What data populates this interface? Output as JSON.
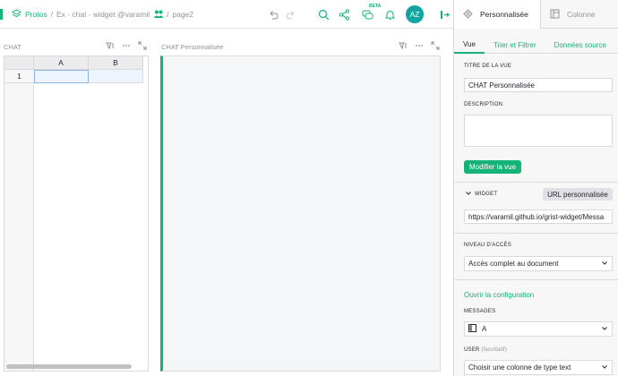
{
  "breadcrumb": {
    "project": "Protos",
    "doc": "Ex - chat - widget @varamil",
    "page": "page2",
    "sep": "/"
  },
  "toolbar": {
    "beta": "BETA",
    "avatar": "AZ"
  },
  "sections": {
    "left_title": "CHAT",
    "right_title": "CHAT Personnalisée"
  },
  "table": {
    "columns": [
      "A",
      "B"
    ],
    "rows": [
      "1"
    ]
  },
  "right_panel": {
    "tabs": [
      "Personnalisée",
      "Colonne"
    ],
    "subtabs": [
      "Vue",
      "Trier et Filtrer",
      "Données source"
    ],
    "view_title_label": "TITRE DE LA VUE",
    "view_title_value": "CHAT Personnalisée",
    "description_label": "DESCRIPTION",
    "modify_button": "Modifier la vue",
    "widget_label": "WIDGET",
    "widget_button": "URL personnalisée",
    "widget_url": "https://varamil.github.io/grist-widget/Messa",
    "access_label": "NIVEAU D'ACCÈS",
    "access_value": "Accès complet au document",
    "open_config": "Ouvrir la configuration",
    "messages_label": "MESSAGES",
    "messages_value": "A",
    "user_label": "USER",
    "user_optional": "(facultatif)",
    "user_value": "Choisir une colonne de type text"
  },
  "colors": {
    "accent": "#16b378",
    "avatar": "#0ea5a0"
  },
  "icons": [
    "pages-icon",
    "share-users-icon",
    "undo-icon",
    "redo-icon",
    "search-icon",
    "share-icon",
    "assistant-icon",
    "bell-icon",
    "panel-icon",
    "widget-icon",
    "column-icon",
    "sort-filter-icon",
    "more-icon",
    "expand-icon",
    "chevron-down-icon",
    "table-column-icon"
  ]
}
